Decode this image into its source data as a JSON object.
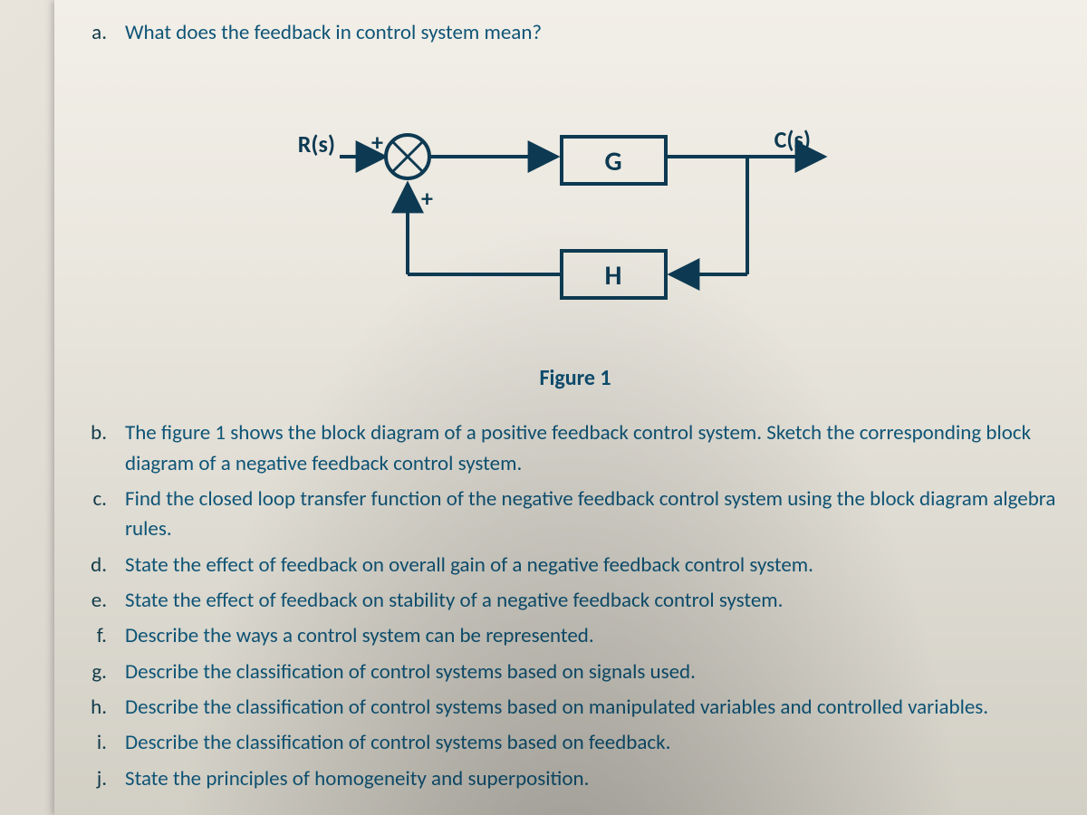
{
  "question_a": {
    "marker": "a.",
    "text": "What does the feedback in control system mean?"
  },
  "figure": {
    "input_label": "R(s)",
    "output_label": "C(s)",
    "sum_sign_top": "+",
    "sum_sign_bottom": "+",
    "block_forward": "G",
    "block_feedback": "H",
    "caption": "Figure 1"
  },
  "items": [
    {
      "marker": "b.",
      "text": "The figure 1 shows the block diagram of a positive feedback control system. Sketch the corresponding block diagram of a negative feedback control system."
    },
    {
      "marker": "c.",
      "text": "Find the closed loop transfer function of the negative feedback control system using the block diagram algebra rules."
    },
    {
      "marker": "d.",
      "text": "State the effect of feedback on overall gain of a negative feedback control system."
    },
    {
      "marker": "e.",
      "text": "State the effect of feedback on stability of a negative feedback control system."
    },
    {
      "marker": "f.",
      "text": "Describe the ways a control system can be represented."
    },
    {
      "marker": "g.",
      "text": "Describe the classification of control systems based on signals used."
    },
    {
      "marker": "h.",
      "text": "Describe the classification of control systems based on manipulated variables and controlled variables."
    },
    {
      "marker": "i.",
      "text": "Describe the classification of control systems based on feedback."
    },
    {
      "marker": "j.",
      "text": "State the principles of homogeneity and superposition."
    }
  ]
}
